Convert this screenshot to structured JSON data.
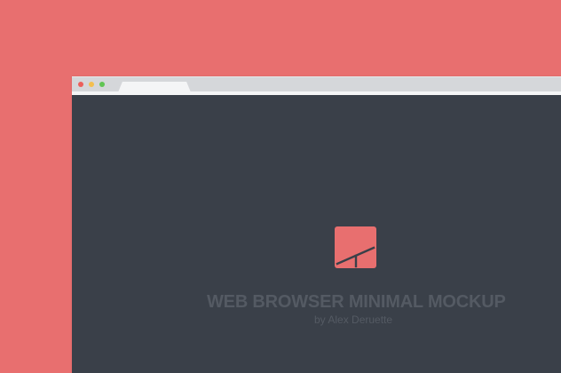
{
  "page": {
    "background_color": "#e86f6f"
  },
  "browser": {
    "window_controls": {
      "close": {
        "icon": "close-light-icon",
        "color": "#ec5f5b"
      },
      "minimize": {
        "icon": "minimize-light-icon",
        "color": "#f4bf4f"
      },
      "zoom": {
        "icon": "zoom-light-icon",
        "color": "#61c554"
      }
    },
    "tab": {
      "title": ""
    },
    "content": {
      "background_color": "#3a4049",
      "logo": {
        "icon": "brand-logo-icon",
        "color": "#e86f6f"
      },
      "title": "WEB BROWSER MINIMAL MOCKUP",
      "author": "by Alex Deruette"
    }
  }
}
